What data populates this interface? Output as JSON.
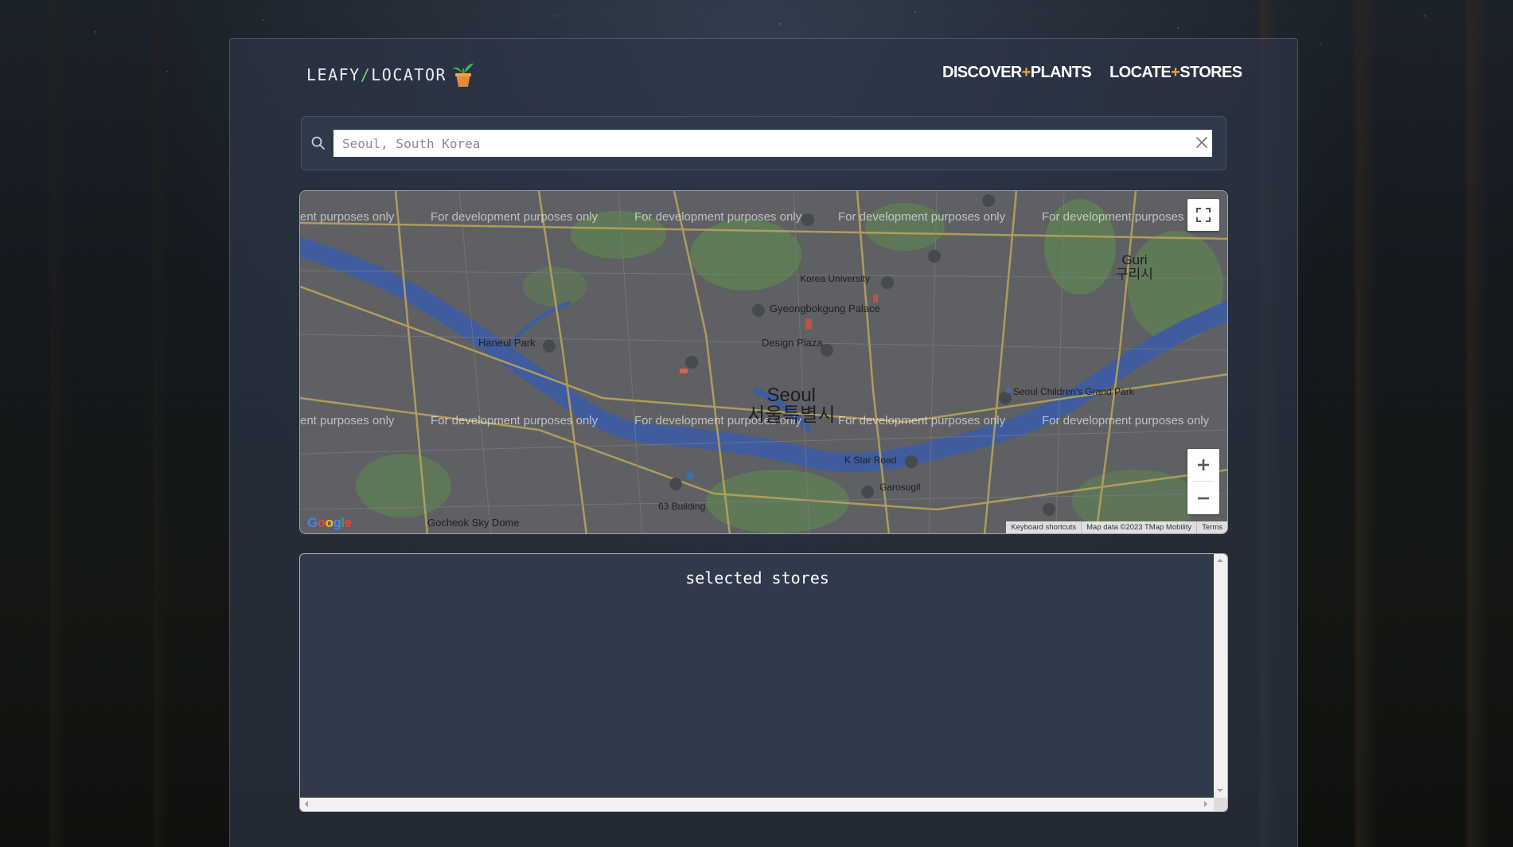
{
  "brand": {
    "part1": "LEAFY",
    "slash": "/",
    "part2": "LOCATOR",
    "logo_icon": "potted-plant-icon"
  },
  "nav": {
    "plants": {
      "left": "DISCOVER",
      "plus": "+",
      "right": "PLANTS"
    },
    "stores": {
      "left": "LOCATE",
      "plus": "+",
      "right": "STORES"
    }
  },
  "search": {
    "placeholder": "Seoul, South Korea",
    "value": "",
    "icon": "search-icon",
    "clear_icon": "close-icon"
  },
  "map": {
    "watermark": "For development purposes only",
    "watermark_cut": "ent purposes only",
    "city_name": "Seoul",
    "city_name_kr": "서울특별시",
    "nearby_city": "Guri",
    "nearby_city_kr": "구리시",
    "places": [
      "Korea University",
      "Gyeongbokgung Palace",
      "Design Plaza",
      "Haneul Park",
      "Seoul Children's Grand Park",
      "K Star Road",
      "Garosugil",
      "63 Building",
      "Gocheok Sky Dome"
    ],
    "google_logo": "Google",
    "attribution": {
      "shortcuts": "Keyboard shortcuts",
      "data": "Map data ©2023 TMap Mobility",
      "terms": "Terms"
    },
    "zoom_in": "+",
    "zoom_out": "−"
  },
  "stores": {
    "title": "selected stores"
  },
  "colors": {
    "accent_green": "#6fcf66",
    "accent_orange": "#f2a23a",
    "panel": "#2f3a4b",
    "river": "#3f5c9e"
  }
}
